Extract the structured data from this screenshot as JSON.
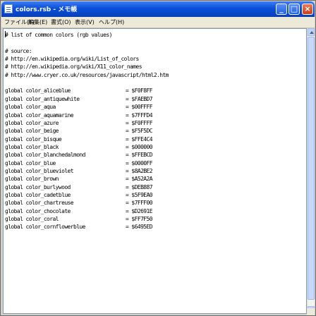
{
  "window": {
    "title": "colors.rsb - メモ帳"
  },
  "menu": [
    "ファイル(F)",
    "編集(E)",
    "書式(O)",
    "表示(V)",
    "ヘルプ(H)"
  ],
  "lines": [
    {
      "text": "# list of common colors (rgb values)"
    },
    {
      "text": ""
    },
    {
      "text": "# source:"
    },
    {
      "text": "# http://en.wikipedia.org/wiki/List_of_colors"
    },
    {
      "text": "# http://en.wikipedia.org/wiki/X11_color_names"
    },
    {
      "text": "# http://www.cryer.co.uk/resources/javascript/html2.htm"
    },
    {
      "text": ""
    },
    {
      "text": "global color_aliceblue",
      "value": "= $F0F8FF"
    },
    {
      "text": "global color_antiquewhite",
      "value": "= $FAEBD7"
    },
    {
      "text": "global color_aqua",
      "value": "= $00FFFF"
    },
    {
      "text": "global color_aquamarine",
      "value": "= $7FFFD4"
    },
    {
      "text": "global color_azure",
      "value": "= $F0FFFF"
    },
    {
      "text": "global color_beige",
      "value": "= $F5F5DC"
    },
    {
      "text": "global color_bisque",
      "value": "= $FFE4C4"
    },
    {
      "text": "global color_black",
      "value": "= $000000"
    },
    {
      "text": "global color_blanchedalmond",
      "value": "= $FFEBCD"
    },
    {
      "text": "global color_blue",
      "value": "= $0000FF"
    },
    {
      "text": "global color_blueviolet",
      "value": "= $8A2BE2"
    },
    {
      "text": "global color_brown",
      "value": "= $A52A2A"
    },
    {
      "text": "global color_burlywood",
      "value": "= $DEB887"
    },
    {
      "text": "global color_cadetblue",
      "value": "= $5F9EA0"
    },
    {
      "text": "global color_chartreuse",
      "value": "= $7FFF00"
    },
    {
      "text": "global color_chocolate",
      "value": "= $D2691E"
    },
    {
      "text": "global color_coral",
      "value": "= $FF7F50"
    },
    {
      "text": "global color_cornflowerblue",
      "value": "= $6495ED"
    }
  ]
}
